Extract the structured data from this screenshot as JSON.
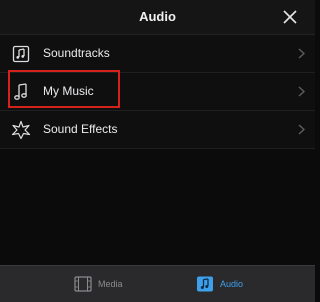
{
  "header": {
    "title": "Audio"
  },
  "rows": [
    {
      "label": "Soundtracks",
      "icon": "soundtracks-icon"
    },
    {
      "label": "My Music",
      "icon": "music-note-icon"
    },
    {
      "label": "Sound Effects",
      "icon": "sound-effects-icon"
    }
  ],
  "tabbar": {
    "media_label": "Media",
    "audio_label": "Audio"
  },
  "colors": {
    "accent": "#3ea0ea",
    "highlight": "#d4231d",
    "background": "#0b0b0c"
  }
}
